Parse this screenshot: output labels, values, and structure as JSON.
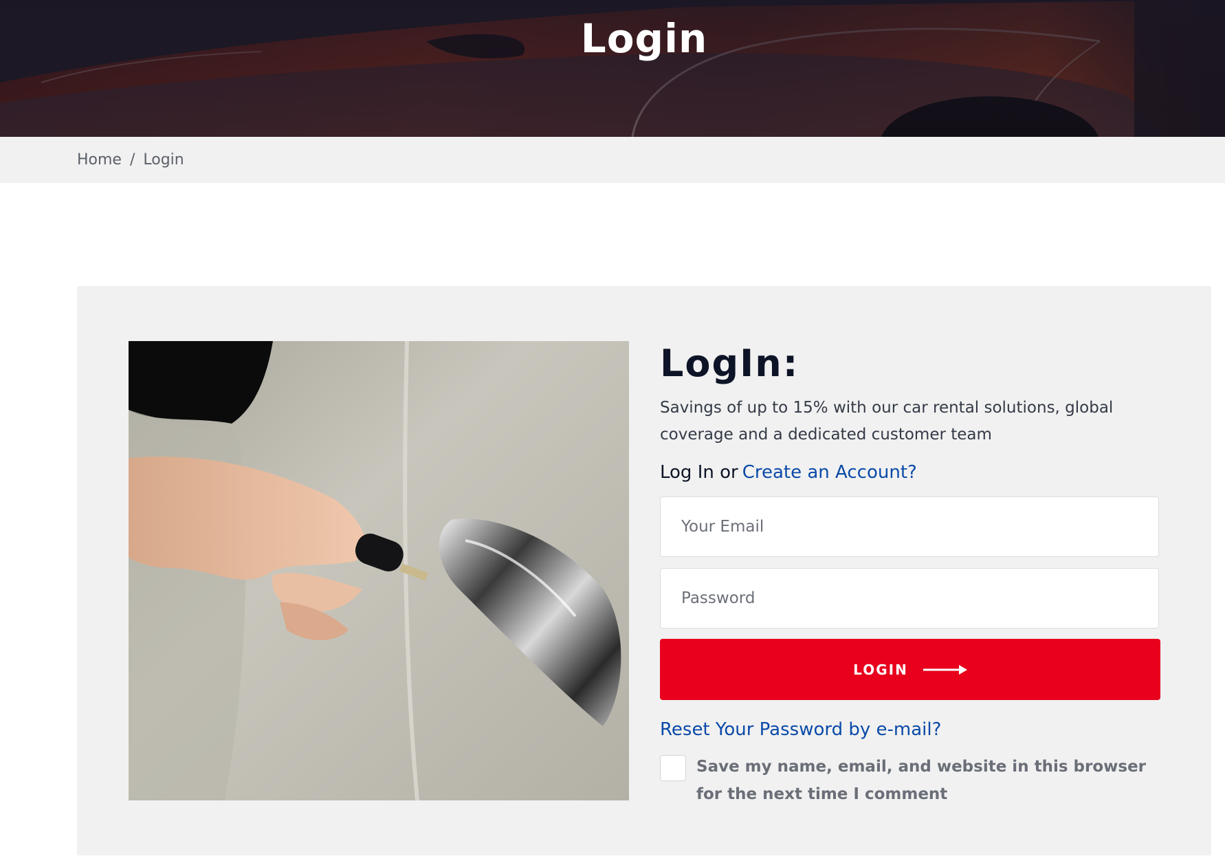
{
  "hero": {
    "title": "Login"
  },
  "breadcrumb": {
    "home": "Home",
    "separator": "/",
    "current": "Login"
  },
  "login": {
    "heading": "LogIn:",
    "description": "Savings of up to 15% with our car rental solutions, global coverage and a dedicated customer team",
    "prompt": "Log In or",
    "create_account_link": "Create an Account?",
    "email_placeholder": "Your Email",
    "password_placeholder": "Password",
    "submit_label": "LOGIN",
    "reset_link": "Reset Your Password by e-mail?",
    "remember_label": "Save my name, email, and website in this browser for the next time I comment"
  },
  "colors": {
    "accent": "#e8001d",
    "link": "#0a4aa8",
    "heading": "#0d1427",
    "panel": "#f1f1f1"
  }
}
